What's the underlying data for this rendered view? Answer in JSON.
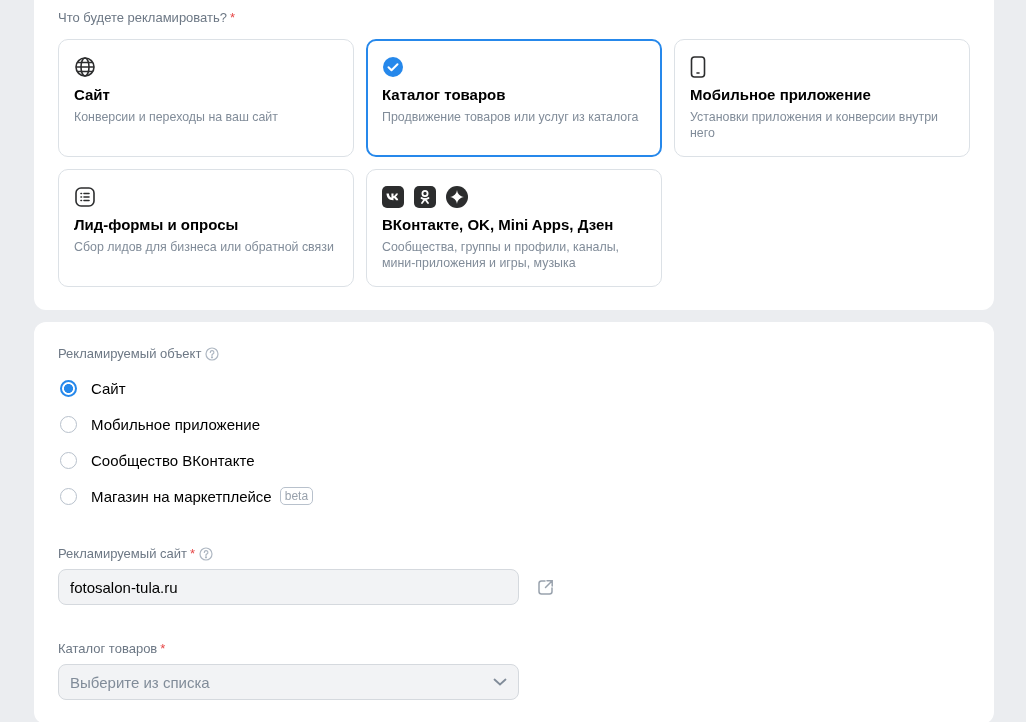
{
  "targets": {
    "label": "Что будете рекламировать?",
    "required": "*",
    "cards": [
      {
        "kind": "globe",
        "title": "Сайт",
        "description": "Конверсии и переходы на ваш сайт",
        "selected": false
      },
      {
        "kind": "check",
        "title": "Каталог товаров",
        "description": "Продвижение товаров или услуг из каталога",
        "selected": true
      },
      {
        "kind": "phone",
        "title": "Мобильное приложение",
        "description": "Установки приложения и конверсии внутри него",
        "selected": false
      },
      {
        "kind": "list",
        "title": "Лид-формы и опросы",
        "description": "Сбор лидов для бизнеса или обратной связи",
        "selected": false
      },
      {
        "kind": "social",
        "title": "ВКонтакте, OK, Mini Apps, Дзен",
        "description": "Сообщества, группы и профили, каналы, мини-приложения и игры, музыка",
        "selected": false
      }
    ]
  },
  "object": {
    "label": "Рекламируемый объект",
    "help": true,
    "options": [
      {
        "label": "Сайт",
        "selected": true
      },
      {
        "label": "Мобильное приложение",
        "selected": false
      },
      {
        "label": "Сообщество ВКонтакте",
        "selected": false
      },
      {
        "label": "Магазин на маркетплейсе",
        "selected": false,
        "badge": "beta"
      }
    ]
  },
  "site": {
    "label": "Рекламируемый сайт",
    "required": "*",
    "help": true,
    "value": "fotosalon-tula.ru"
  },
  "catalog": {
    "label": "Каталог товаров",
    "required": "*",
    "placeholder": "Выберите из списка"
  }
}
